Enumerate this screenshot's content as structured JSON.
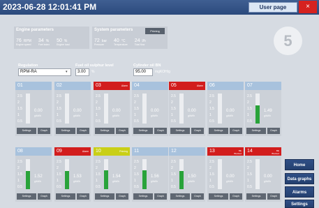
{
  "titlebar": {
    "datetime": "2023-06-28 12:01:41 PM",
    "user_button": "User page",
    "close_label": "×"
  },
  "badge": "5",
  "engine": {
    "title": "Engine parameters",
    "items": [
      {
        "value": "76",
        "unit": "RPM",
        "caption": "Engine speed"
      },
      {
        "value": "34",
        "unit": "%",
        "caption": "Fuel index"
      },
      {
        "value": "50",
        "unit": "%",
        "caption": "Engine load"
      }
    ]
  },
  "system": {
    "title": "System parameters",
    "priming_label": "Priming",
    "items": [
      {
        "value": "72",
        "unit": "bar",
        "caption": "Pressure"
      },
      {
        "value": "40",
        "unit": "°C",
        "caption": "Temperature"
      },
      {
        "value": "24",
        "unit": "l/h",
        "caption": "Total flow"
      }
    ]
  },
  "settings": {
    "regulation_label": "Regulation",
    "regulation_value": "RPM-RA",
    "sulphur_label": "Fuel oil sulphur level",
    "sulphur_value": "3.00",
    "sulphur_unit": "%",
    "bn_label": "Cylinder oil BN",
    "bn_value": "95.00",
    "bn_unit": "mgKOH/g"
  },
  "ticks": [
    "2.5",
    "2",
    "1.5",
    "1",
    "0.5"
  ],
  "cyl_value_unit": "g/kWh",
  "cyl_settings_label": "Settings",
  "cyl_graph_label": "Graph",
  "cylinders": [
    {
      "num": "01",
      "status": "normal",
      "alarm": "",
      "value": "0.00",
      "fill": 0.0
    },
    {
      "num": "02",
      "status": "normal",
      "alarm": "",
      "value": "0.00",
      "fill": 0.0
    },
    {
      "num": "03",
      "status": "alarm",
      "alarm": "Alarm",
      "value": "0.00",
      "fill": 0.0
    },
    {
      "num": "04",
      "status": "normal",
      "alarm": "",
      "value": "0.00",
      "fill": 0.0
    },
    {
      "num": "05",
      "status": "alarm",
      "alarm": "Alarm",
      "value": "0.00",
      "fill": 0.0
    },
    {
      "num": "06",
      "status": "normal",
      "alarm": "",
      "value": "0.00",
      "fill": 0.0
    },
    {
      "num": "07",
      "status": "normal",
      "alarm": "",
      "value": "1.49",
      "fill": 0.6
    },
    {
      "num": "08",
      "status": "normal",
      "alarm": "",
      "value": "1.52",
      "fill": 0.61
    },
    {
      "num": "09",
      "status": "alarm",
      "alarm": "Alarm",
      "value": "1.53",
      "fill": 0.61
    },
    {
      "num": "10",
      "status": "warn",
      "alarm": "Priming",
      "value": "1.54",
      "fill": 0.62
    },
    {
      "num": "11",
      "status": "normal",
      "alarm": "",
      "value": "1.56",
      "fill": 0.62
    },
    {
      "num": "12",
      "status": "normal",
      "alarm": "",
      "value": "1.50",
      "fill": 0.6
    },
    {
      "num": "13",
      "status": "alarm",
      "alarm": "Blk\nBlocked",
      "value": "0.00",
      "fill": 0.0
    },
    {
      "num": "14",
      "status": "alarm",
      "alarm": "Blk\nBlocked",
      "value": "0.00",
      "fill": 0.0
    }
  ],
  "nav": [
    "Home",
    "Data graphs",
    "Alarms",
    "Settings"
  ]
}
